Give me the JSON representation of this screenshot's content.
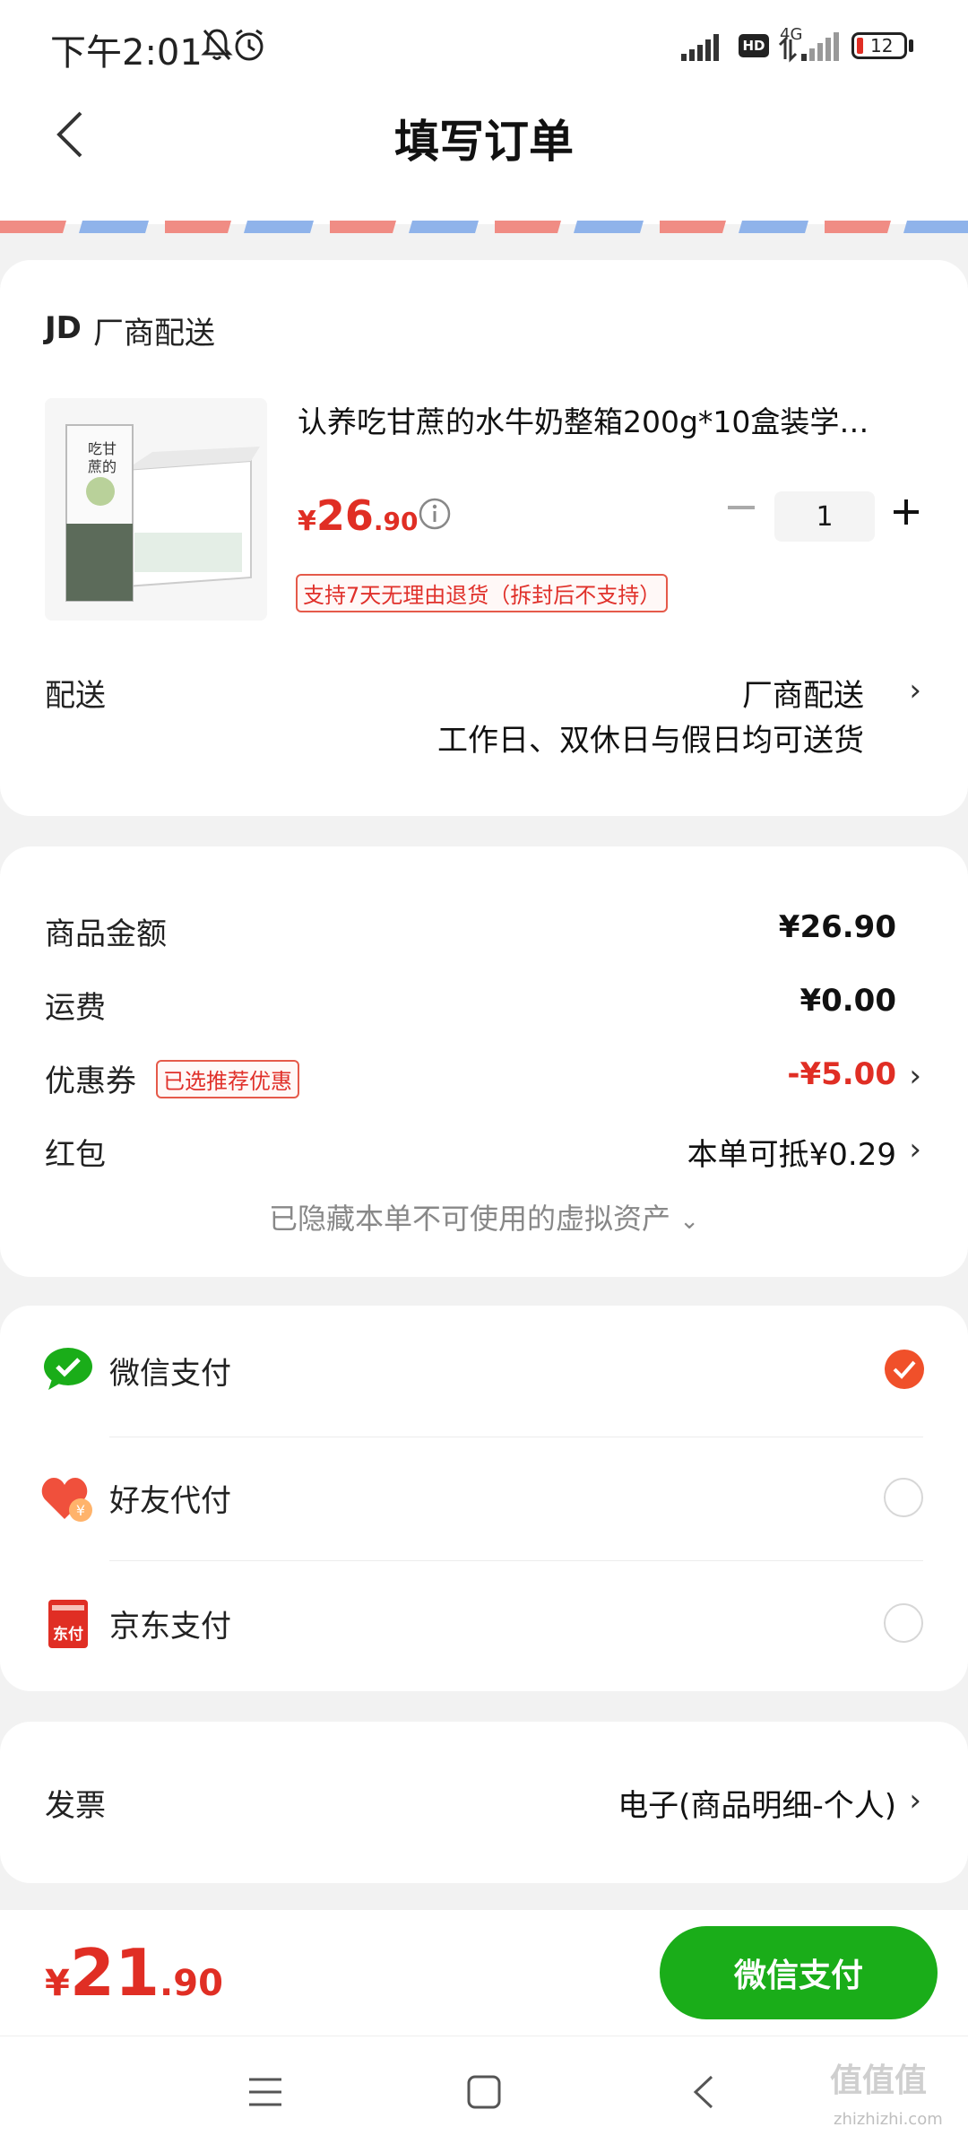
{
  "status_bar": {
    "time": "下午2:01",
    "network": "4G",
    "battery": "12"
  },
  "header": {
    "title": "填写订单"
  },
  "shop": {
    "logo": "JD",
    "name": "厂商配送"
  },
  "product": {
    "title": "认养吃甘蔗的水牛奶整箱200g*10盒装学…",
    "price_symbol": "¥",
    "price_int": "26",
    "price_dec": ".90",
    "quantity": "1",
    "return_policy": "支持7天无理由退货（拆封后不支持）"
  },
  "delivery": {
    "label": "配送",
    "method": "厂商配送",
    "note": "工作日、双休日与假日均可送货"
  },
  "summary": {
    "goods_label": "商品金额",
    "goods_value": "¥26.90",
    "shipping_label": "运费",
    "shipping_value": "¥0.00",
    "coupon_label": "优惠券",
    "coupon_tag": "已选推荐优惠",
    "coupon_value": "-¥5.00",
    "redpacket_label": "红包",
    "redpacket_value": "本单可抵¥0.29",
    "hidden_assets": "已隐藏本单不可使用的虚拟资产"
  },
  "payment": {
    "options": [
      {
        "label": "微信支付",
        "selected": true
      },
      {
        "label": "好友代付",
        "selected": false
      },
      {
        "label": "京东支付",
        "selected": false
      }
    ],
    "jd_icon_text": "东付"
  },
  "invoice": {
    "label": "发票",
    "value": "电子(商品明细-个人)"
  },
  "footer": {
    "total_symbol": "¥",
    "total_int": "21",
    "total_dec": ".90",
    "pay_button": "微信支付"
  },
  "watermark": {
    "site": "zhizhizhi.com"
  },
  "colors": {
    "accent_red": "#e02e24",
    "wechat_green": "#1aad19",
    "selected_check": "#f0502a"
  }
}
